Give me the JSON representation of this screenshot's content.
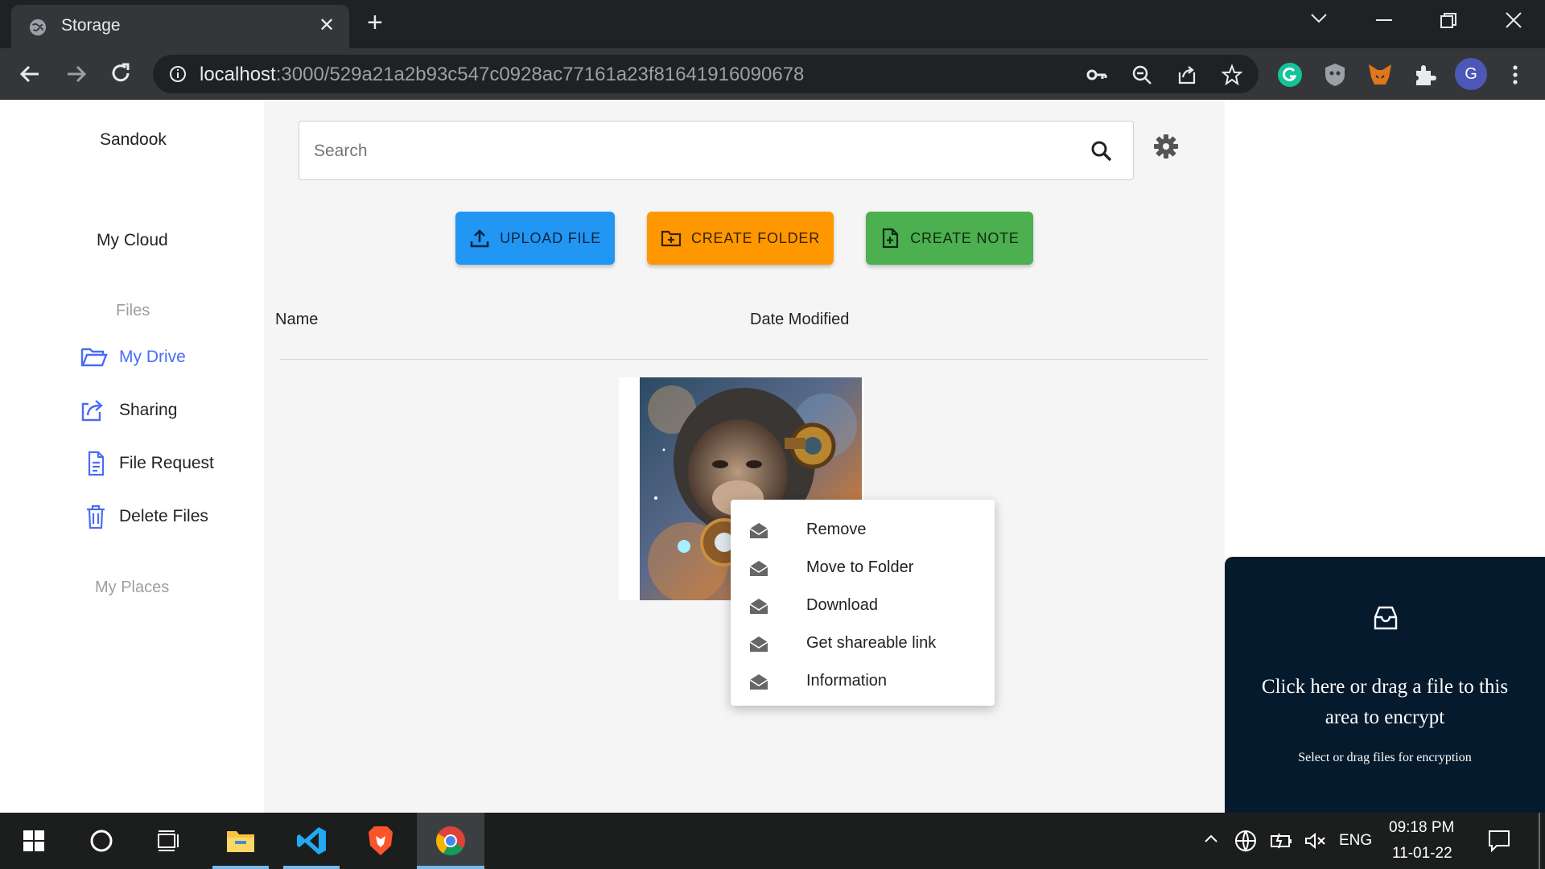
{
  "browser": {
    "tab_title": "Storage",
    "url_host": "localhost",
    "url_path": ":3000/529a21a2b93c547c0928ac77161a23f81641916090678",
    "profile_initial": "G"
  },
  "sidebar": {
    "brand": "Sandook",
    "my_cloud": "My Cloud",
    "files_label": "Files",
    "items": [
      {
        "label": "My Drive",
        "icon": "folder-open-icon",
        "active": true
      },
      {
        "label": "Sharing",
        "icon": "share-icon",
        "active": false
      },
      {
        "label": "File Request",
        "icon": "file-text-icon",
        "active": false
      },
      {
        "label": "Delete Files",
        "icon": "trash-icon",
        "active": false
      }
    ],
    "places_label": "My Places"
  },
  "main": {
    "search_placeholder": "Search",
    "buttons": {
      "upload": "UPLOAD FILE",
      "create_folder": "CREATE FOLDER",
      "create_note": "CREATE NOTE"
    },
    "columns": {
      "name": "Name",
      "date_modified": "Date Modified"
    }
  },
  "context_menu": {
    "items": [
      {
        "label": "Remove",
        "icon": "envelope-open-icon"
      },
      {
        "label": "Move to Folder",
        "icon": "envelope-open-icon"
      },
      {
        "label": "Download",
        "icon": "envelope-open-icon"
      },
      {
        "label": "Get shareable link",
        "icon": "envelope-open-icon"
      },
      {
        "label": "Information",
        "icon": "envelope-open-icon"
      }
    ]
  },
  "dropzone": {
    "title": "Click here or drag a file to this area to encrypt",
    "subtitle": "Select or drag files for encryption"
  },
  "taskbar": {
    "language": "ENG",
    "time": "09:18 PM",
    "date": "11-01-22"
  },
  "colors": {
    "upload": "#2196f3",
    "folder": "#ff9800",
    "note": "#4caf50",
    "active_nav": "#4a6cf7",
    "dropzone_bg": "#061a2d"
  }
}
